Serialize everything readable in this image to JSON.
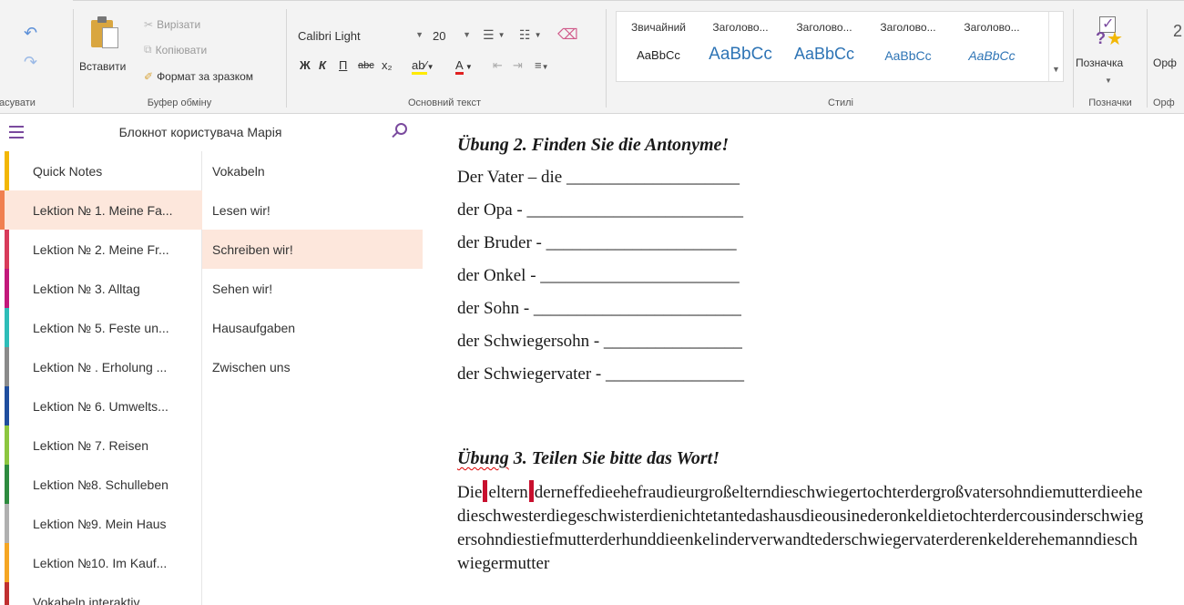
{
  "ribbon": {
    "undo_label": "Скасувати",
    "clipboard": {
      "paste_label": "Вставити",
      "cut_label": "Вирізати",
      "copy_label": "Копіювати",
      "format_painter_label": "Формат за зразком",
      "group_label": "Буфер обміну"
    },
    "font": {
      "family": "Calibri Light",
      "size": "20",
      "bold": "Ж",
      "italic": "К",
      "underline": "П",
      "strike": "abc",
      "subscript": "x₂",
      "group_label": "Основний текст"
    },
    "styles": {
      "items": [
        {
          "name": "Звичайний",
          "sample": "AaBbCc"
        },
        {
          "name": "Заголово...",
          "sample": "AaBbCc"
        },
        {
          "name": "Заголово...",
          "sample": "AaBbCc"
        },
        {
          "name": "Заголово...",
          "sample": "AaBbCc"
        },
        {
          "name": "Заголово...",
          "sample": "AaBbCc"
        }
      ],
      "group_label": "Стилі"
    },
    "tags": {
      "tag_label": "Позначка",
      "group_label": "Позначки"
    },
    "spelling": {
      "label": "Орф",
      "group_label": "Орф"
    }
  },
  "notebook": {
    "title": "Блокнот користувача Марія",
    "sections": [
      {
        "label": "Quick Notes",
        "color": "#f2b705"
      },
      {
        "label": "Lektion № 1. Meine Fa...",
        "color": "#f08050"
      },
      {
        "label": "Lektion № 2. Meine Fr...",
        "color": "#d83b5a"
      },
      {
        "label": "Lektion № 3. Alltag",
        "color": "#c2187a"
      },
      {
        "label": "Lektion № 5. Feste un...",
        "color": "#2dbdb8"
      },
      {
        "label": "Lektion № . Erholung ...",
        "color": "#8a8a8a"
      },
      {
        "label": "Lektion № 6. Umwelts...",
        "color": "#1f4e9e"
      },
      {
        "label": "Lektion № 7. Reisen",
        "color": "#8cc63f"
      },
      {
        "label": "Lektion №8. Schulleben",
        "color": "#2e8b3f"
      },
      {
        "label": "Lektion №9. Mein Haus",
        "color": "#b0b0b0"
      },
      {
        "label": "Lektion №10. Im Kauf...",
        "color": "#f5a623"
      },
      {
        "label": "Vokabeln interaktiv",
        "color": "#c03030"
      }
    ],
    "pages": [
      {
        "label": "Vokabeln"
      },
      {
        "label": "Lesen wir!"
      },
      {
        "label": "Schreiben wir!"
      },
      {
        "label": "Sehen wir!"
      },
      {
        "label": "Hausaufgaben"
      },
      {
        "label": "Zwischen uns"
      }
    ]
  },
  "content": {
    "exercise2": {
      "heading": "Übung 2. Finden Sie die Antonyme!",
      "lines": [
        "Der Vater – die ____________________",
        "der Opa - _________________________",
        "der Bruder - ______________________",
        "der Onkel - _______________________",
        "der Sohn - ________________________",
        "der Schwiegersohn - ________________",
        "der Schwiegervater - ________________"
      ]
    },
    "exercise3": {
      "heading_word": "Übung",
      "heading_rest": " 3. Teilen Sie bitte das Wort!",
      "text_prefix": "Die",
      "text_mid": "eltern",
      "text_rest": "derneffedieehefraudieurgroßelterndieschwiegertochterdergroßvatersohndiemutterdieehedieschwesterdiegeschwisterdienichtetantedashausdieousinederonkeldietochterdercousinderschwiegersohndiestiefmutterderhunddieenkelinderverwandtederschwiegervaterderenkelderehemanndieschwiegermutter"
    }
  }
}
